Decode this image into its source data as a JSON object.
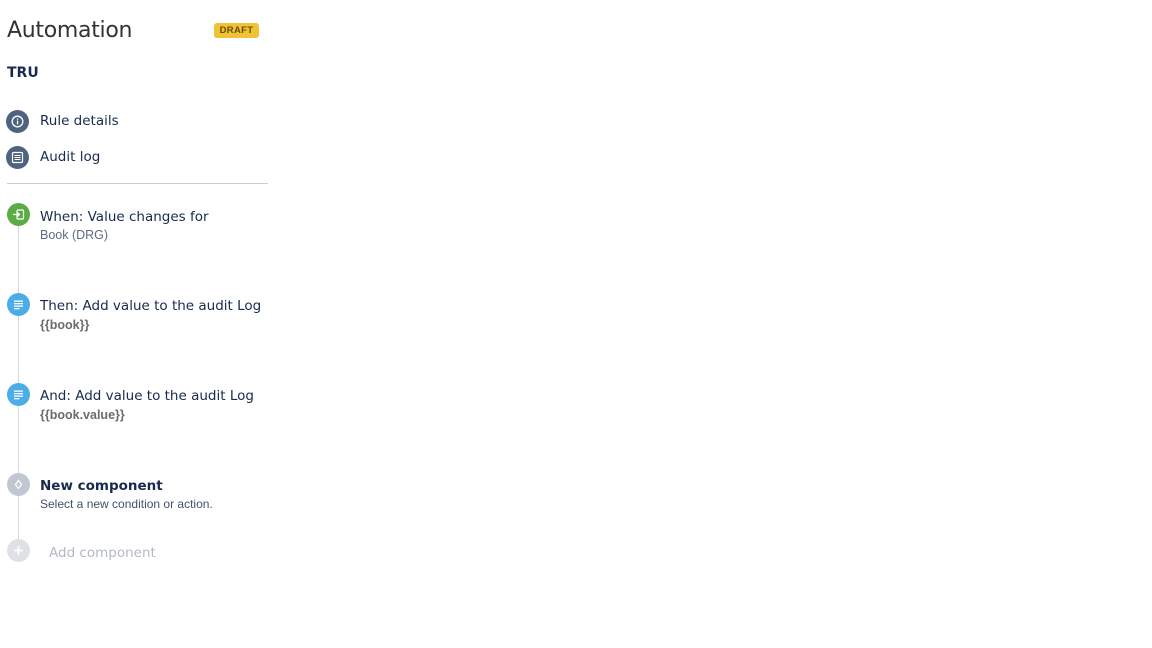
{
  "header": {
    "title": "Automation",
    "status": "DRAFT",
    "status_color": "#f0c236",
    "project_key": "TRU"
  },
  "nav": {
    "items": [
      {
        "label": "Rule details",
        "icon": "info-icon"
      },
      {
        "label": "Audit log",
        "icon": "list-icon"
      }
    ]
  },
  "rule": {
    "steps": [
      {
        "title": "When: Value changes for",
        "subtitle": "Book (DRG)",
        "icon": "trigger-icon",
        "color": "#5aac44"
      },
      {
        "title": "Then: Add value to the audit Log",
        "subtitle": "{{book}}",
        "icon": "document-icon",
        "color": "#4bade8"
      },
      {
        "title": "And: Add value to the audit Log",
        "subtitle": "{{book.value}}",
        "icon": "document-icon",
        "color": "#4bade8"
      },
      {
        "title": "New component",
        "subtitle": "Select a new condition or action.",
        "icon": "diamond-icon",
        "color": "#c1c7d0"
      }
    ],
    "add_component_label": "Add component"
  }
}
